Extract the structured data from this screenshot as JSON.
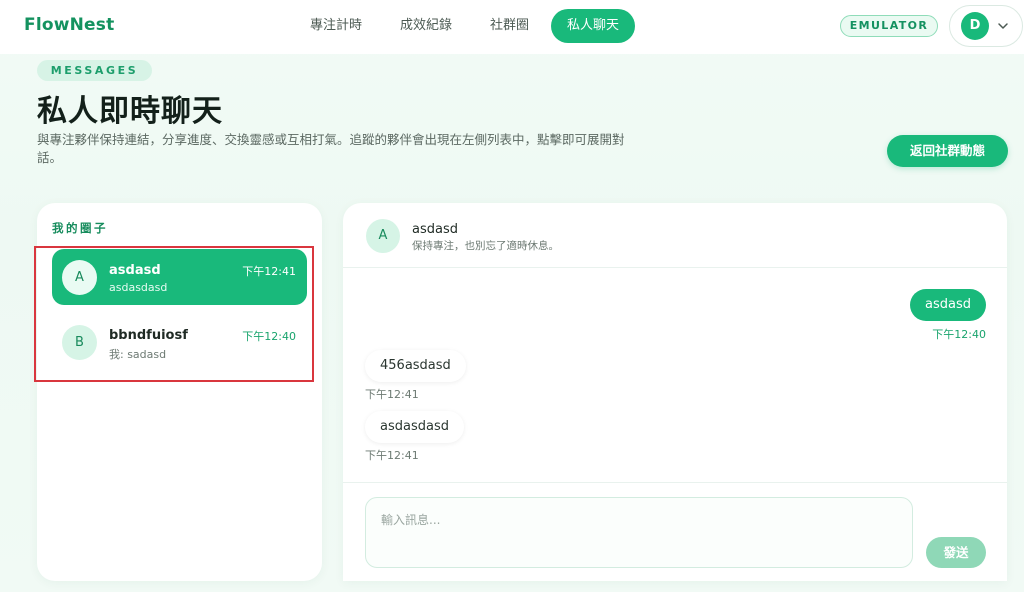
{
  "brand": "FlowNest",
  "nav": {
    "items": [
      {
        "label": "專注計時",
        "active": false
      },
      {
        "label": "成效紀錄",
        "active": false
      },
      {
        "label": "社群圈",
        "active": false
      },
      {
        "label": "私人聊天",
        "active": true
      }
    ]
  },
  "emulator_badge": "EMULATOR",
  "user": {
    "avatar_letter": "D"
  },
  "header": {
    "eyebrow": "MESSAGES",
    "title": "私人即時聊天",
    "description": "與專注夥伴保持連結，分享進度、交換靈感或互相打氣。追蹤的夥伴會出現在左側列表中，點擊即可展開對話。",
    "back_button": "返回社群動態"
  },
  "sidebar": {
    "heading": "我的圈子",
    "conversations": [
      {
        "avatar": "A",
        "name": "asdasd",
        "preview": "asdasdasd",
        "time": "下午12:41",
        "selected": true
      },
      {
        "avatar": "B",
        "name": "bbndfuiosf",
        "preview": "我: sadasd",
        "time": "下午12:40",
        "selected": false
      }
    ]
  },
  "chat": {
    "contact": {
      "avatar": "A",
      "name": "asdasd",
      "status": "保持專注，也別忘了適時休息。"
    },
    "messages": [
      {
        "direction": "out",
        "text": "asdasd",
        "time": "下午12:40"
      },
      {
        "direction": "in",
        "text": "456asdasd",
        "time": "下午12:41"
      },
      {
        "direction": "in",
        "text": "asdasdasd",
        "time": "下午12:41"
      }
    ],
    "input_placeholder": "輸入訊息...",
    "send_button": "發送"
  },
  "colors": {
    "accent": "#19b97b",
    "brand_text": "#14925f",
    "send_disabled": "#8fd8b7",
    "highlight_outline": "#d9363e",
    "page_bg": "#f1faf5"
  }
}
